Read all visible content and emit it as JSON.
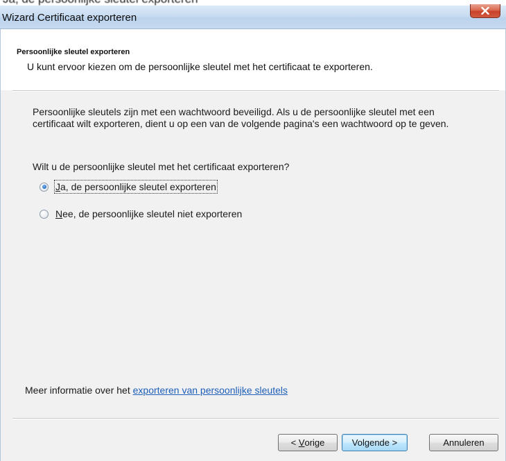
{
  "background_text": "Ja, de persoonlijke sleutel exporteren",
  "window": {
    "title": "Wizard Certificaat exporteren",
    "close_icon": "close-icon"
  },
  "header": {
    "title": "Persoonlijke sleutel exporteren",
    "subtitle": "U kunt ervoor kiezen om de persoonlijke sleutel met het certificaat te exporteren."
  },
  "body": {
    "paragraph": "Persoonlijke sleutels zijn met een wachtwoord beveiligd. Als u de persoonlijke sleutel met een certificaat wilt exporteren, dient u op een van de volgende pagina's een wachtwoord op te geven.",
    "question": "Wilt u de persoonlijke sleutel met het certificaat exporteren?",
    "options": [
      {
        "accel": "J",
        "rest": "a, de persoonlijke sleutel exporteren",
        "checked": true
      },
      {
        "accel": "N",
        "rest": "ee, de persoonlijke sleutel niet exporteren",
        "checked": false
      }
    ]
  },
  "footer": {
    "info_prefix": "Meer informatie over het",
    "info_link": "exporteren van persoonlijke sleutels"
  },
  "buttons": {
    "back_prefix": "< ",
    "back_accel": "V",
    "back_rest": "orige",
    "next": "Volgende >",
    "cancel": "Annuleren"
  },
  "colors": {
    "accent": "#3c7fb1",
    "link": "#1d5fb8",
    "close": "#c8432a"
  }
}
